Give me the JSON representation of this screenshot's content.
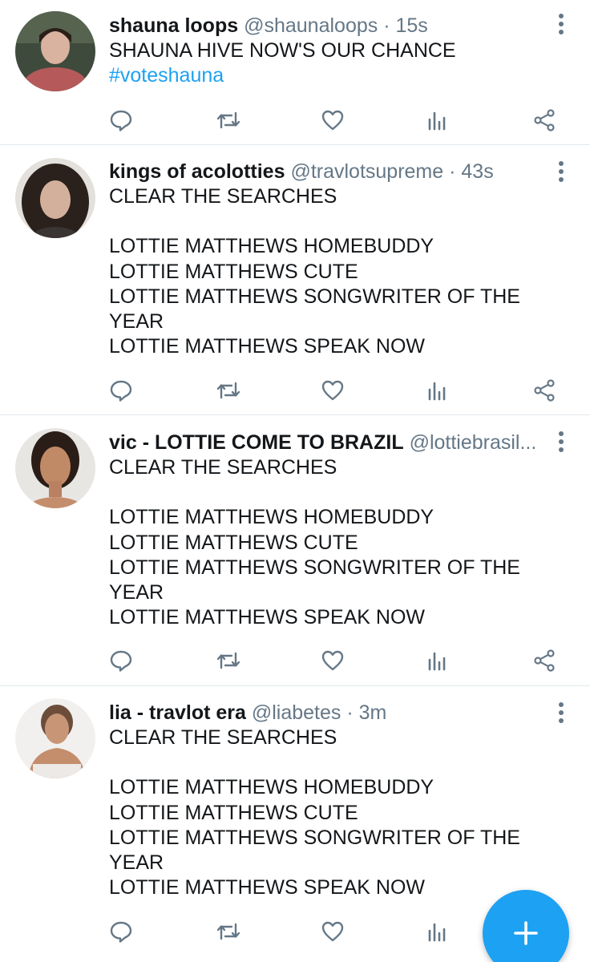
{
  "colors": {
    "accent": "#1da1f2",
    "secondary_text": "#657786",
    "primary_text": "#14171a",
    "divider": "#e1e8ed"
  },
  "icons": {
    "reply": "reply-icon",
    "retweet": "retweet-icon",
    "like": "heart-icon",
    "stats": "analytics-icon",
    "share": "share-icon",
    "more": "more-vertical-icon",
    "compose": "plus-icon"
  },
  "tweets": [
    {
      "display_name": "shauna loops",
      "handle": "@shaunaloops",
      "separator": "·",
      "time": "15s",
      "text": "SHAUNA HIVE NOW'S OUR CHANCE",
      "hashtag": "#voteshauna"
    },
    {
      "display_name": "kings of acolotties",
      "handle": "@travlotsupreme",
      "separator": "·",
      "time": "43s",
      "text": "CLEAR THE SEARCHES\n\nLOTTIE MATTHEWS HOMEBUDDY\nLOTTIE MATTHEWS CUTE\nLOTTIE MATTHEWS SONGWRITER OF THE YEAR\nLOTTIE MATTHEWS SPEAK NOW"
    },
    {
      "display_name": "vic - LOTTIE COME TO BRAZIL",
      "handle": "@lottiebrasil...",
      "separator": "",
      "time": "",
      "text": "CLEAR THE SEARCHES\n\nLOTTIE MATTHEWS HOMEBUDDY\nLOTTIE MATTHEWS CUTE\nLOTTIE MATTHEWS SONGWRITER OF THE YEAR\nLOTTIE MATTHEWS SPEAK NOW"
    },
    {
      "display_name": "lia - travlot era",
      "handle": "@liabetes",
      "separator": "·",
      "time": "3m",
      "text": "CLEAR THE SEARCHES\n\nLOTTIE MATTHEWS HOMEBUDDY\nLOTTIE MATTHEWS CUTE\nLOTTIE MATTHEWS SONGWRITER OF THE YEAR\nLOTTIE MATTHEWS SPEAK NOW"
    }
  ]
}
